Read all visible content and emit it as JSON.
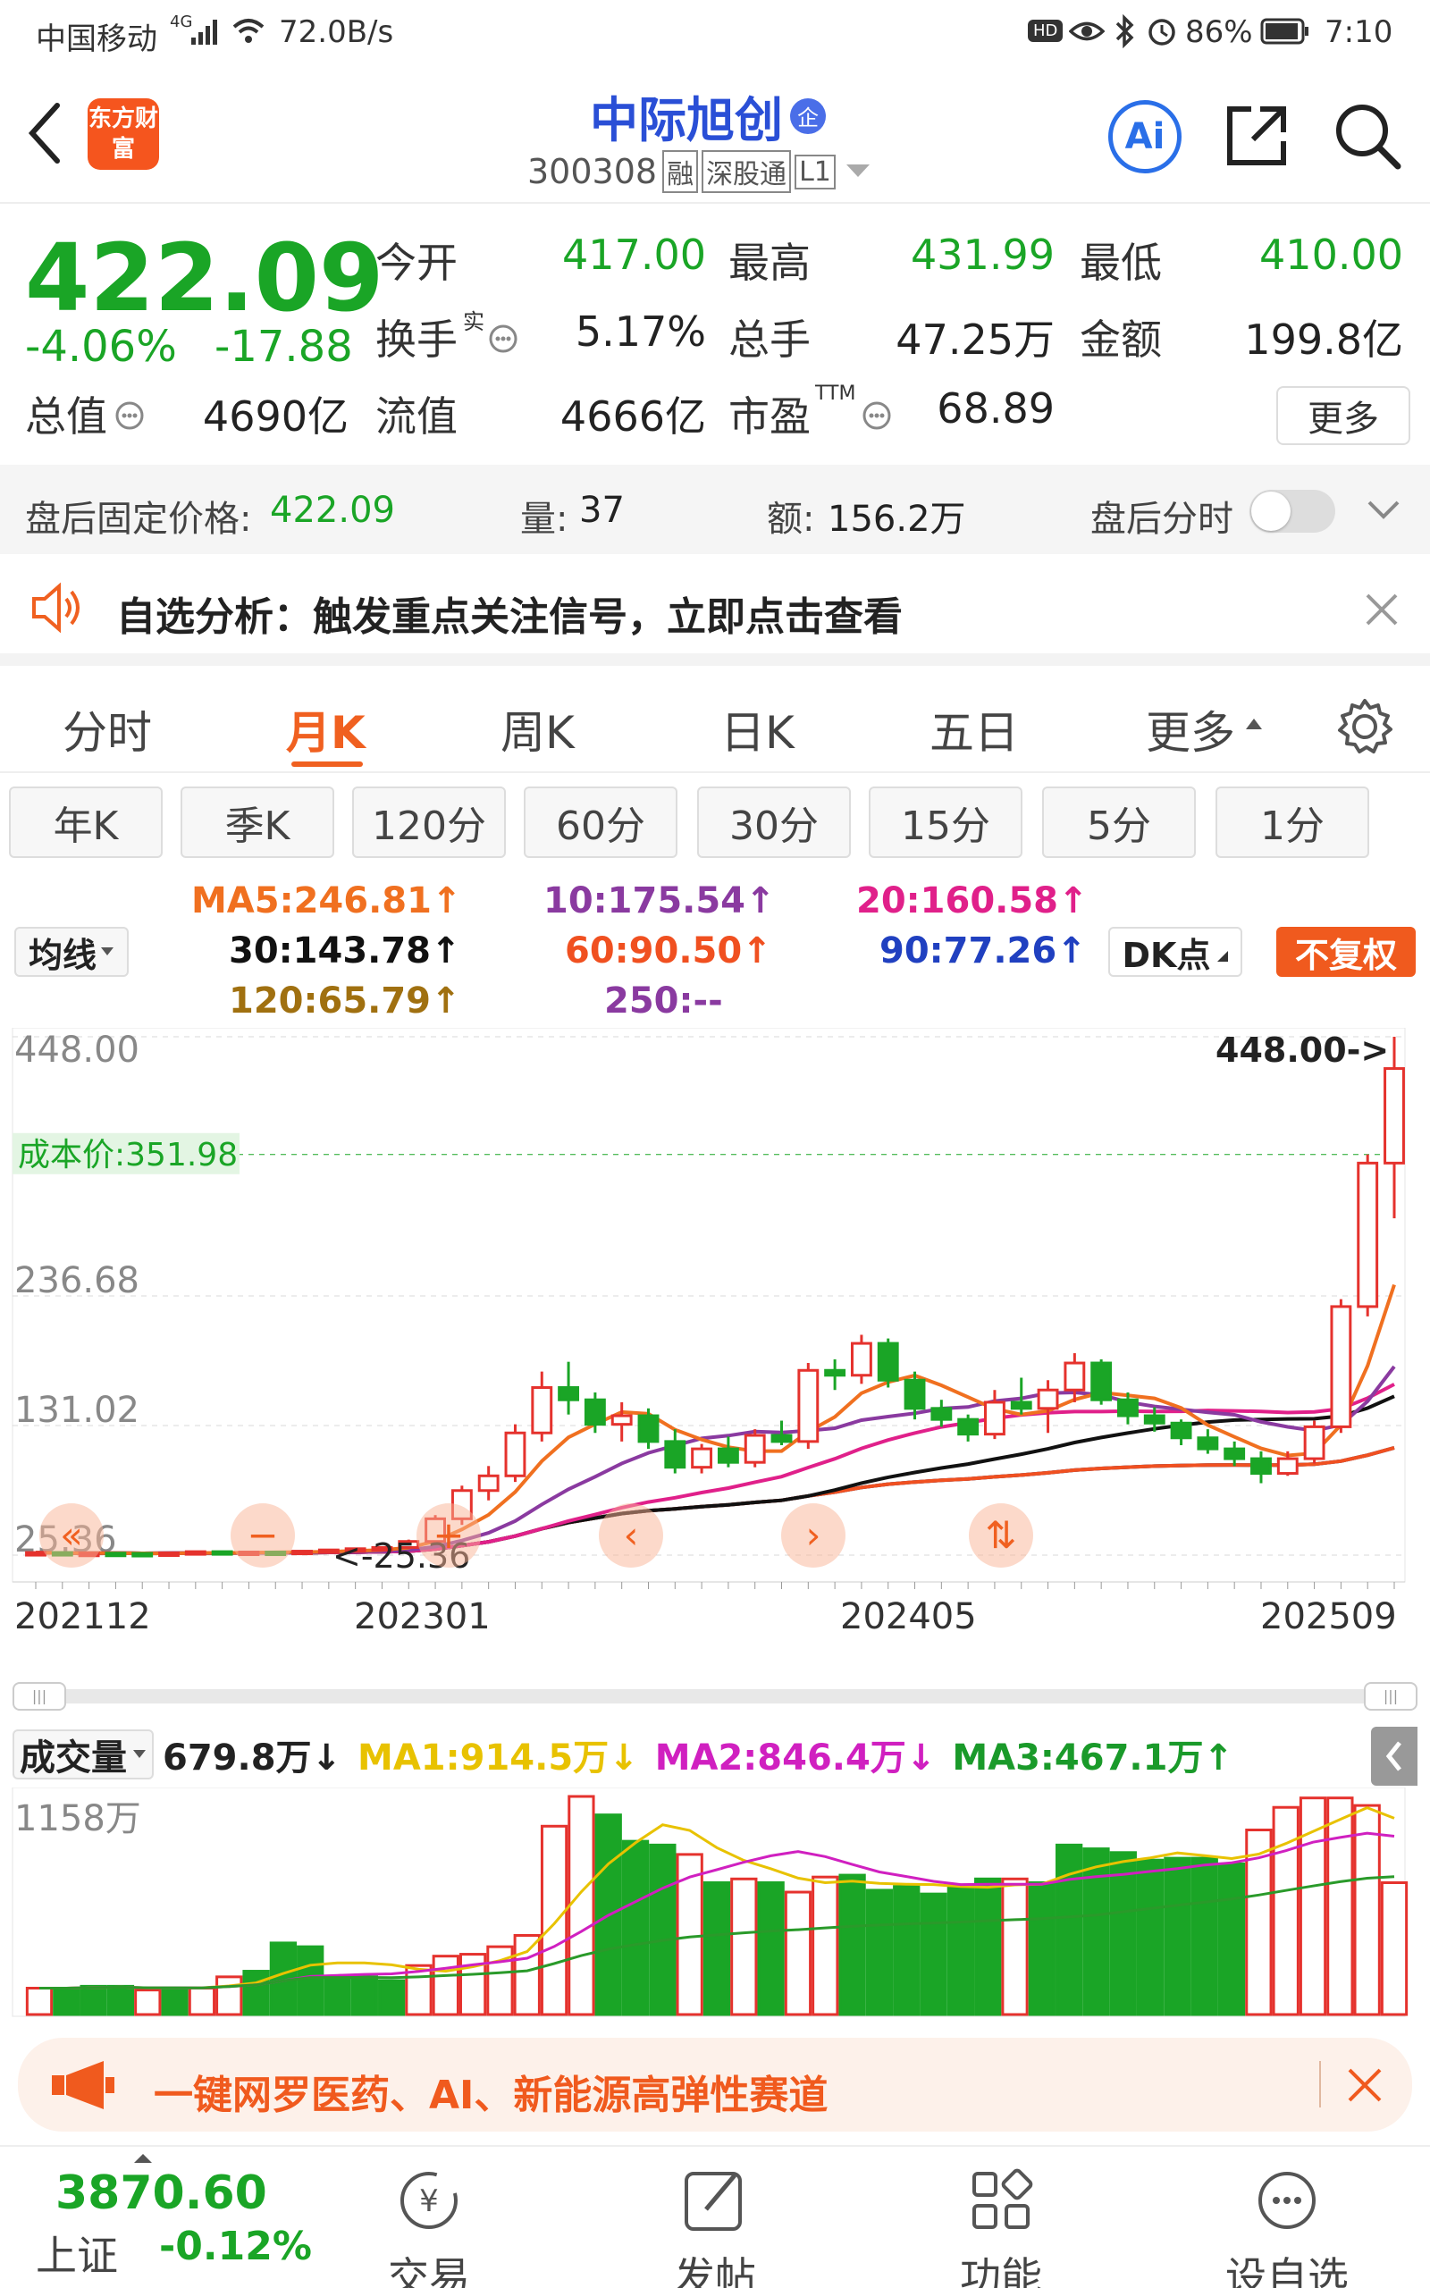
{
  "status_bar": {
    "carrier": "中国移动",
    "network": "4G",
    "speed": "72.0B/s",
    "hd": "HD",
    "battery": "86%",
    "time": "7:10"
  },
  "header": {
    "logo_text": "东方财富",
    "stock_name": "中际旭创",
    "name_badge": "企",
    "code": "300308",
    "tag_rong": "融",
    "tag_sgt": "深股通",
    "tag_l1": "L1",
    "ai_label": "Ai"
  },
  "quote": {
    "price": "422.09",
    "change_pct": "-4.06%",
    "change": "-17.88",
    "open_label": "今开",
    "open": "417.00",
    "high_label": "最高",
    "high": "431.99",
    "low_label": "最低",
    "low": "410.00",
    "turnover_label": "换手",
    "turnover_sup": "实",
    "turnover": "5.17%",
    "volume_label": "总手",
    "volume": "47.25万",
    "amount_label": "金额",
    "amount": "199.8亿",
    "mcap_label": "总值",
    "mcap": "4690亿",
    "float_label": "流值",
    "float": "4666亿",
    "pe_label": "市盈",
    "pe_sup": "TTM",
    "pe": "68.89",
    "more_button": "更多"
  },
  "after_hours": {
    "price_label": "盘后固定价格:",
    "price": "422.09",
    "vol_label": "量:",
    "vol": "37",
    "amt_label": "额:",
    "amt": "156.2万",
    "switch_label": "盘后分时"
  },
  "alert": {
    "text": "自选分析：触发重点关注信号，立即点击查看"
  },
  "tabs": [
    "分时",
    "月K",
    "周K",
    "日K",
    "五日",
    "更多"
  ],
  "subtabs": [
    "年K",
    "季K",
    "120分",
    "60分",
    "30分",
    "15分",
    "5分",
    "1分"
  ],
  "ma_panel": {
    "selector": "均线",
    "ma5": "MA5:246.81↑",
    "ma10": "10:175.54↑",
    "ma20": "20:160.58↑",
    "ma30": "30:143.78↑",
    "ma60": "60:90.50↑",
    "ma90": "90:77.26↑",
    "ma120": "120:65.79↑",
    "ma250": "250:--",
    "dk_button": "DK点",
    "fq_button": "不复权"
  },
  "colors": {
    "up": "#e5322d",
    "down": "#1aa526",
    "ma5": "#f07020",
    "ma10": "#8a3aa0",
    "ma20": "#e0208a",
    "ma30": "#111111",
    "ma60": "#f05020",
    "ma90": "#2040c0",
    "ma120": "#a07010",
    "vol_ma1": "#e8c200",
    "vol_ma2": "#d020c0",
    "vol_ma3": "#2a9a2a",
    "accent": "#ff6a13"
  },
  "chart_data": [
    {
      "type": "candlestick",
      "title": "",
      "y_ticks": [
        "448.00",
        "236.68",
        "131.02",
        "25.36"
      ],
      "x_ticks": [
        "202112",
        "202301",
        "202405",
        "202509"
      ],
      "max_marker": "448.00->",
      "min_marker": "<-25.36",
      "cost_line_label": "成本价:351.98",
      "cost_line_value": 351.98,
      "ylim": [
        25.36,
        448.0
      ],
      "candles": [
        [
          27,
          28,
          25.36,
          27.5
        ],
        [
          27.5,
          28.5,
          26,
          26.5
        ],
        [
          26.5,
          27.5,
          25.8,
          27
        ],
        [
          27,
          28,
          26,
          26.8
        ],
        [
          26.8,
          27.5,
          25.8,
          26.3
        ],
        [
          26.3,
          27.5,
          25.6,
          27.2
        ],
        [
          27.2,
          28.6,
          26.6,
          28.2
        ],
        [
          28.2,
          29,
          27,
          27.4
        ],
        [
          27.4,
          28.5,
          26.4,
          27.9
        ],
        [
          27.9,
          28.8,
          26.9,
          27.3
        ],
        [
          27.3,
          29,
          26.9,
          28.6
        ],
        [
          28.6,
          30,
          27.9,
          29.6
        ],
        [
          29.6,
          31,
          28.6,
          30.6
        ],
        [
          30.6,
          32,
          29.6,
          31.6
        ],
        [
          31.6,
          38,
          30.6,
          36.5
        ],
        [
          36.5,
          58,
          34.5,
          55
        ],
        [
          55,
          82,
          50,
          78
        ],
        [
          78,
          98,
          70,
          90
        ],
        [
          90,
          132,
          85,
          125
        ],
        [
          125,
          175,
          118,
          162
        ],
        [
          162,
          183,
          140,
          152
        ],
        [
          152,
          158,
          125,
          132
        ],
        [
          132,
          150,
          118,
          139
        ],
        [
          139,
          145,
          112,
          118
        ],
        [
          118,
          128,
          92,
          97
        ],
        [
          97,
          116,
          92,
          112
        ],
        [
          112,
          122,
          97,
          101
        ],
        [
          101,
          128,
          97,
          123
        ],
        [
          123,
          135,
          115,
          118
        ],
        [
          118,
          182,
          112,
          176
        ],
        [
          176,
          185,
          160,
          172
        ],
        [
          172,
          205,
          165,
          198
        ],
        [
          198,
          202,
          162,
          168
        ],
        [
          168,
          175,
          136,
          145
        ],
        [
          145,
          152,
          130,
          136
        ],
        [
          136,
          140,
          118,
          124
        ],
        [
          124,
          160,
          120,
          150
        ],
        [
          150,
          170,
          140,
          145
        ],
        [
          145,
          168,
          125,
          160
        ],
        [
          160,
          190,
          150,
          182
        ],
        [
          182,
          185,
          148,
          152
        ],
        [
          152,
          158,
          132,
          139
        ],
        [
          139,
          146,
          126,
          133
        ],
        [
          133,
          136,
          115,
          121
        ],
        [
          121,
          128,
          108,
          112
        ],
        [
          112,
          118,
          98,
          104
        ],
        [
          104,
          110,
          84,
          92
        ],
        [
          92,
          110,
          90,
          104
        ],
        [
          104,
          135,
          100,
          130
        ],
        [
          130,
          234,
          125,
          228
        ],
        [
          228,
          352,
          220,
          345
        ],
        [
          345,
          448,
          300,
          422.09
        ]
      ]
    },
    {
      "type": "bar",
      "title": "",
      "label": "成交量",
      "current": "679.8万↓",
      "ma1": "MA1:914.5万↓",
      "ma2": "MA2:846.4万↓",
      "ma3": "MA3:467.1万↑",
      "y_tick": "1158万",
      "ylim": [
        0,
        1158
      ],
      "values": [
        140,
        140,
        150,
        150,
        130,
        140,
        140,
        200,
        230,
        380,
        360,
        200,
        200,
        180,
        260,
        310,
        320,
        360,
        420,
        1000,
        1158,
        1060,
        920,
        900,
        850,
        700,
        720,
        700,
        650,
        730,
        740,
        660,
        680,
        640,
        680,
        720,
        720,
        700,
        900,
        880,
        860,
        820,
        830,
        830,
        800,
        980,
        1100,
        1150,
        1150,
        1110,
        700
      ],
      "up": [
        true,
        false,
        false,
        false,
        true,
        false,
        true,
        true,
        false,
        false,
        false,
        false,
        false,
        false,
        true,
        true,
        true,
        true,
        true,
        true,
        true,
        false,
        false,
        false,
        true,
        false,
        true,
        false,
        true,
        true,
        false,
        false,
        false,
        false,
        false,
        false,
        true,
        false,
        false,
        false,
        false,
        false,
        false,
        false,
        false,
        true,
        true,
        true,
        true,
        true,
        true
      ]
    }
  ],
  "vol_banner": {
    "text": "一键网罗医药、AI、新能源高弹性赛道"
  },
  "bottom_nav": {
    "index_value": "3870.60",
    "index_name": "上证",
    "index_change": "-0.12%",
    "items": [
      "交易",
      "发帖",
      "功能",
      "设自选"
    ]
  }
}
